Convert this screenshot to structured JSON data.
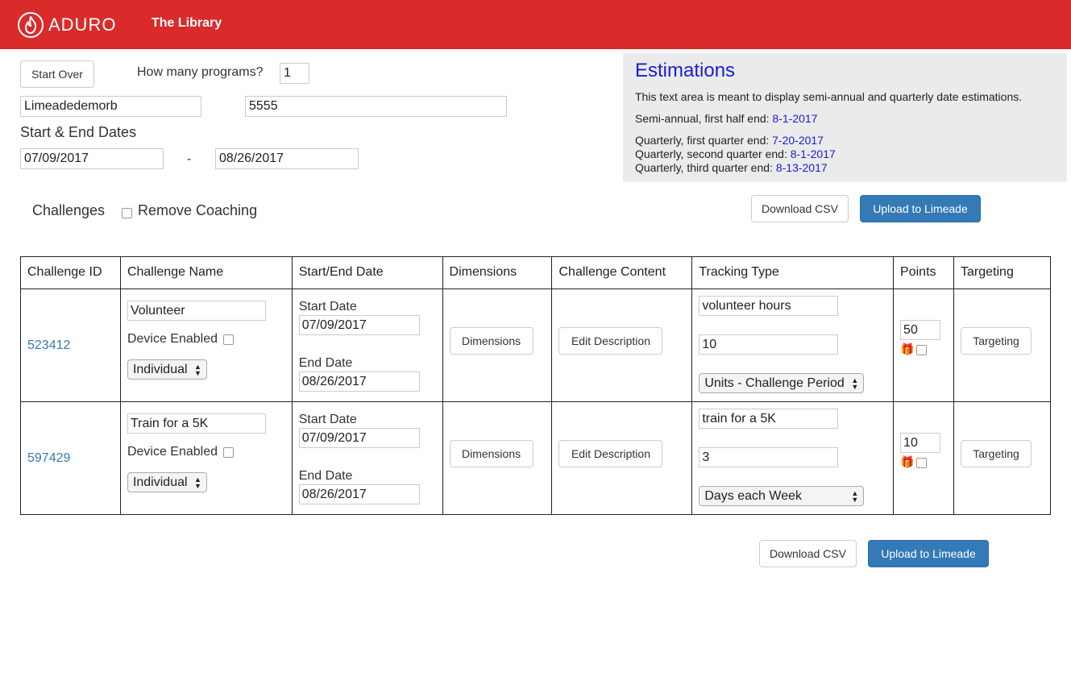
{
  "header": {
    "logo_text": "ADURO",
    "app_title": "The Library"
  },
  "controls": {
    "start_over": "Start Over",
    "programs_label": "How many programs?",
    "programs_value": "1",
    "org_name": "Limeadedemorb",
    "org_id": "5555",
    "dates_label": "Start & End Dates",
    "start_date": "07/09/2017",
    "dash": "-",
    "end_date": "08/26/2017",
    "challenges_label": "Challenges",
    "remove_coaching": "Remove Coaching"
  },
  "estimations": {
    "title": "Estimations",
    "intro": "This text area is meant to display semi-annual and quarterly date estimations.",
    "semi_label": "Semi-annual, first half end: ",
    "semi_value": "8-1-2017",
    "q1_label": "Quarterly, first quarter end: ",
    "q1_value": "7-20-2017",
    "q2_label": "Quarterly, second quarter end: ",
    "q2_value": "8-1-2017",
    "q3_label": "Quarterly, third quarter end: ",
    "q3_value": "8-13-2017"
  },
  "actions": {
    "download_csv": "Download CSV",
    "upload": "Upload to Limeade"
  },
  "table": {
    "headers": [
      "Challenge ID",
      "Challenge Name",
      "Start/End Date",
      "Dimensions",
      "Challenge Content",
      "Tracking Type",
      "Points",
      "Targeting"
    ],
    "rows": [
      {
        "id": "523412",
        "name": "Volunteer",
        "device_label": "Device Enabled",
        "type": "Individual",
        "start_label": "Start Date",
        "start": "07/09/2017",
        "end_label": "End Date",
        "end": "08/26/2017",
        "dimensions": "Dimensions",
        "edit": "Edit Description",
        "tracking_name": "volunteer hours",
        "tracking_value": "10",
        "tracking_unit": "Units - Challenge Period",
        "points": "50",
        "targeting": "Targeting"
      },
      {
        "id": "597429",
        "name": "Train for a 5K",
        "device_label": "Device Enabled",
        "type": "Individual",
        "start_label": "Start Date",
        "start": "07/09/2017",
        "end_label": "End Date",
        "end": "08/26/2017",
        "dimensions": "Dimensions",
        "edit": "Edit Description",
        "tracking_name": "train for a 5K",
        "tracking_value": "3",
        "tracking_unit": "Days each Week",
        "points": "10",
        "targeting": "Targeting"
      }
    ]
  }
}
